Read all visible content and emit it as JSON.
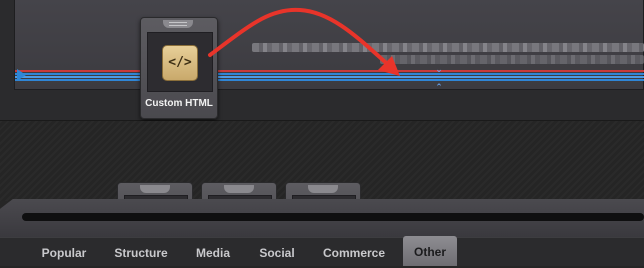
{
  "colors": {
    "accent": "#e8342a",
    "timeline_blue": "#2f86d6",
    "timeline_red": "#c83a3a",
    "active_tab": "#7d7c81"
  },
  "drag_widget": {
    "label": "Custom HTML",
    "icon": "code-brackets-icon",
    "icon_glyph": "</>"
  },
  "tray_widgets": [
    {
      "icon": "pink-blob-icon"
    },
    {
      "icon": "orange-image-icon"
    },
    {
      "icon": "blue-person-icon"
    }
  ],
  "tabs": [
    {
      "label": "Popular",
      "active": false
    },
    {
      "label": "Structure",
      "active": false
    },
    {
      "label": "Media",
      "active": false
    },
    {
      "label": "Social",
      "active": false
    },
    {
      "label": "Commerce",
      "active": false
    },
    {
      "label": "Other",
      "active": true
    }
  ]
}
